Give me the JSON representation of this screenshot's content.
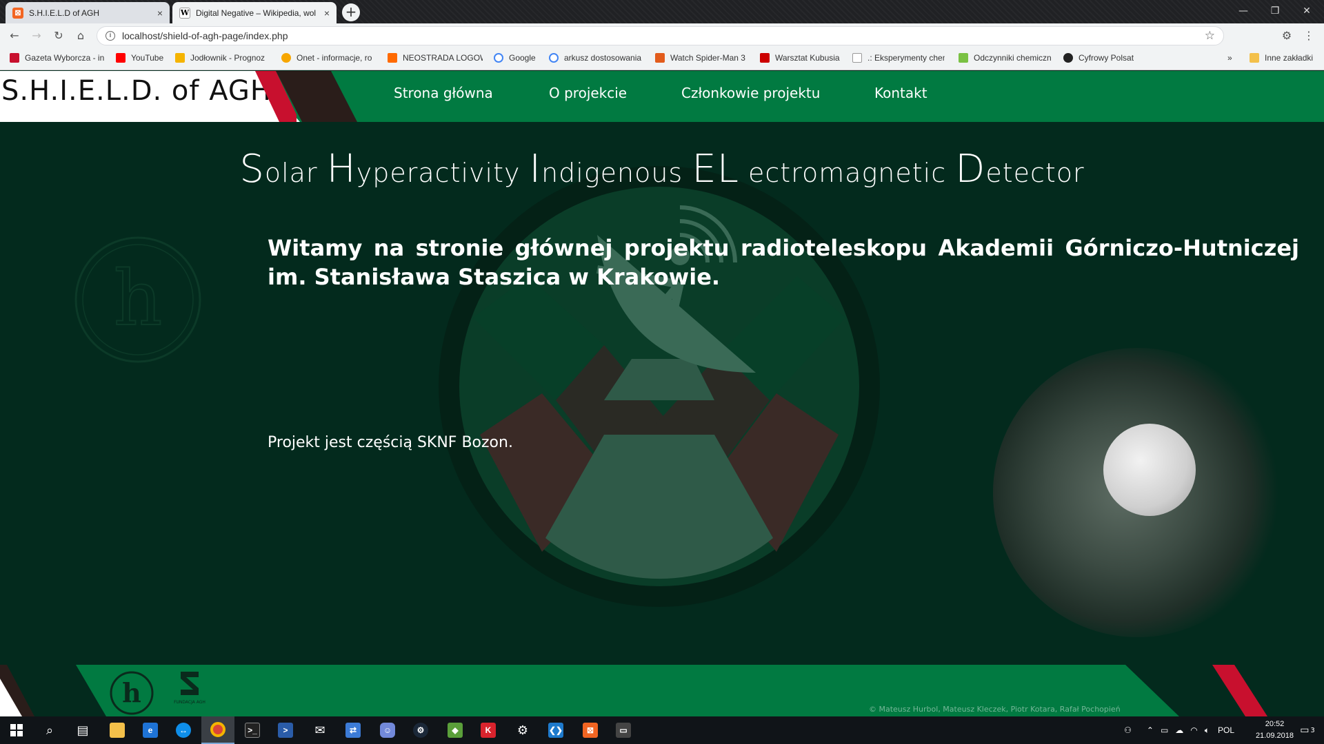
{
  "browser": {
    "tabs": [
      {
        "title": "S.H.I.E.L.D of AGH",
        "close": "×"
      },
      {
        "title": "Digital Negative – Wikipedia, wol",
        "close": "×"
      }
    ],
    "new_tab": "+",
    "window_controls": {
      "minimize": "—",
      "restore": "❐",
      "close": "✕"
    },
    "address": "localhost/shield-of-agh-page/index.php",
    "bookmarks": [
      {
        "label": "Gazeta Wyborcza - in",
        "color": "#c8102e"
      },
      {
        "label": "YouTube",
        "color": "#ff0000"
      },
      {
        "label": "Jodłownik - Prognoz",
        "color": "#f5b400"
      },
      {
        "label": "Onet - informacje, ro",
        "color": "#f7a600"
      },
      {
        "label": "NEOSTRADA LOGOW",
        "color": "#ff6a00"
      },
      {
        "label": "Google",
        "color": "#4285f4"
      },
      {
        "label": "arkusz dostosowania",
        "color": "#4285f4"
      },
      {
        "label": "Watch Spider-Man 3",
        "color": "#e25c1c"
      },
      {
        "label": "Warsztat Kubusia",
        "color": "#cc0000"
      },
      {
        "label": ".: Eksperymenty chem",
        "color": "#bbbbbb"
      },
      {
        "label": "Odczynniki chemiczn",
        "color": "#7ac143"
      },
      {
        "label": "Cyfrowy Polsat",
        "color": "#222222"
      }
    ],
    "more_bookmarks": "»",
    "other_bookmarks": "Inne zakładki"
  },
  "site": {
    "logo": "S.H.I.E.L.D. of AGH",
    "nav": [
      "Strona główna",
      "O projekcie",
      "Członkowie projektu",
      "Kontakt"
    ],
    "hero": [
      {
        "cap": "S",
        "rest": "olar "
      },
      {
        "cap": "H",
        "rest": "yperactivity "
      },
      {
        "cap": "I",
        "rest": "ndigenous "
      },
      {
        "cap": "EL",
        "rest": " ectromagnetic "
      },
      {
        "cap": "D",
        "rest": "etector"
      }
    ],
    "welcome": "Witamy na stronie głównej projektu radioteleskopu Akademii Górniczo-Hutniczej im. Stanisława Staszica w Krakowie.",
    "project_note": "Projekt jest częścią SKNF Bozon.",
    "footer_credits": "© Mateusz Hurbol, Mateusz Kleczek, Piotr Kotara, Rafał Pochopień",
    "footer_fund_logo_text": "FUNDACJA AGH"
  },
  "taskbar": {
    "language": "POL",
    "time": "20:52",
    "date": "21.09.2018",
    "notifications": "3"
  },
  "colors": {
    "brand_green": "#017a41",
    "page_bg": "#032a1d",
    "accent_red": "#c8102e",
    "accent_dark": "#2a1d1a"
  }
}
